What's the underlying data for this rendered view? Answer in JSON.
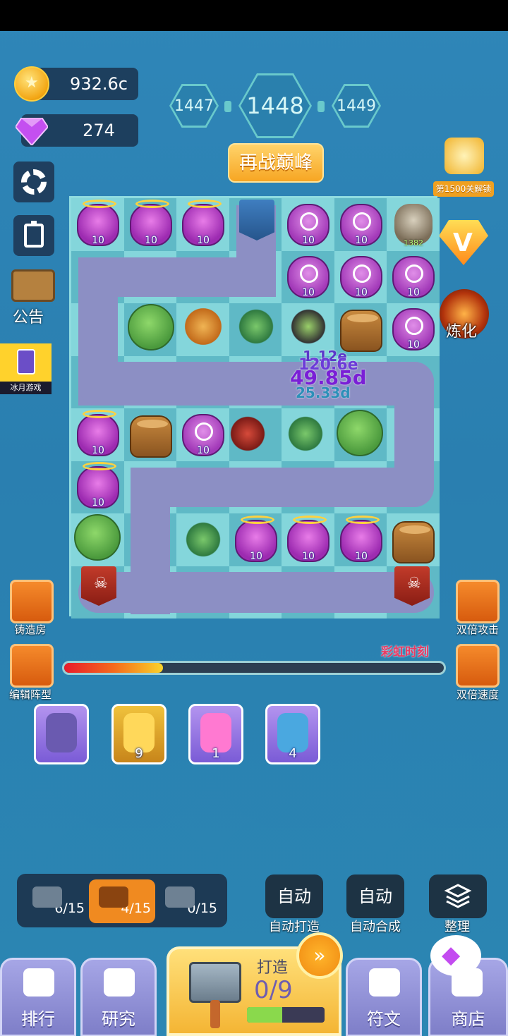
{
  "currency": {
    "coins": "932.6c",
    "gems": "274"
  },
  "levels": {
    "prev": "1447",
    "current": "1448",
    "next": "1449"
  },
  "rechallenge_label": "再战巅峰",
  "left_menu": {
    "notice_label": "公告",
    "ad_label": "冰月游戏"
  },
  "right_menu": {
    "unlock_label": "第1500关解锁",
    "vip_glyph": "V",
    "smelt_label": "炼化"
  },
  "board": {
    "cat_hp": "1382",
    "damage_texts": [
      "1.12e",
      "120.6e",
      "49.85d",
      "25.33d"
    ]
  },
  "units": {
    "pot_level": "10"
  },
  "side_buttons": {
    "forge_room": "铸造房",
    "edit_formation": "编辑阵型",
    "double_attack": "双倍攻击",
    "double_speed": "双倍速度",
    "rainbow": "彩虹时刻"
  },
  "rainbow_progress": 0.26,
  "cards": [
    {
      "num": ""
    },
    {
      "num": "9"
    },
    {
      "num": "1"
    },
    {
      "num": "4"
    }
  ],
  "counters": [
    {
      "value": "6/15"
    },
    {
      "value": "4/15"
    },
    {
      "value": "0/15"
    }
  ],
  "auto": {
    "btn1": "自动",
    "lbl1": "自动打造",
    "btn2": "自动",
    "lbl2": "自动合成",
    "lbl3": "整理"
  },
  "tabs": {
    "rank": "排行",
    "research": "研究",
    "rune": "符文",
    "shop": "商店"
  },
  "forge": {
    "title": "打造",
    "progress_text": "0/9",
    "progress": 0.45
  },
  "colors": {
    "accent": "#f08a20",
    "path": "#8c8fc4",
    "cell_light": "#84d6db",
    "cell_dark": "#5fb9c6"
  }
}
